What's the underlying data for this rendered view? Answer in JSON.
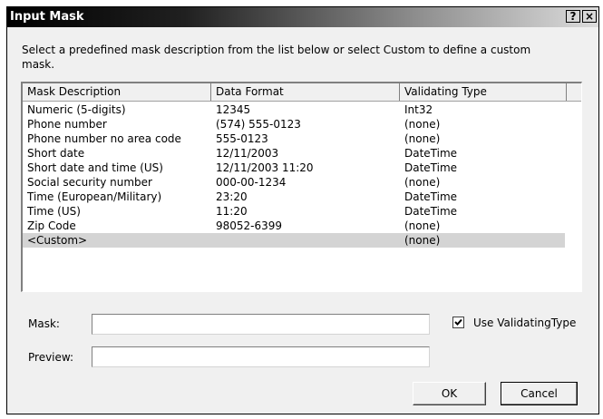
{
  "window": {
    "title": "Input Mask",
    "help_glyph": "?",
    "close_glyph": "×"
  },
  "instructions": "Select a predefined mask description from the list below or select Custom to define a custom mask.",
  "list": {
    "columns": [
      "Mask Description",
      "Data Format",
      "Validating Type"
    ],
    "rows": [
      [
        "Numeric (5-digits)",
        "12345",
        "Int32"
      ],
      [
        "Phone number",
        "(574) 555-0123",
        "(none)"
      ],
      [
        "Phone number no area code",
        "555-0123",
        "(none)"
      ],
      [
        "Short date",
        "12/11/2003",
        "DateTime"
      ],
      [
        "Short date and time (US)",
        "12/11/2003 11:20",
        "DateTime"
      ],
      [
        "Social security number",
        "000-00-1234",
        "(none)"
      ],
      [
        "Time (European/Military)",
        "23:20",
        "DateTime"
      ],
      [
        "Time (US)",
        "11:20",
        "DateTime"
      ],
      [
        "Zip Code",
        "98052-6399",
        "(none)"
      ],
      [
        "<Custom>",
        "",
        "(none)"
      ]
    ],
    "selected_index": 9
  },
  "mask": {
    "label": "Mask:",
    "value": ""
  },
  "preview": {
    "label": "Preview:",
    "value": ""
  },
  "validating_checkbox": {
    "label": "Use ValidatingType",
    "checked": true
  },
  "buttons": {
    "ok": "OK",
    "cancel": "Cancel"
  }
}
